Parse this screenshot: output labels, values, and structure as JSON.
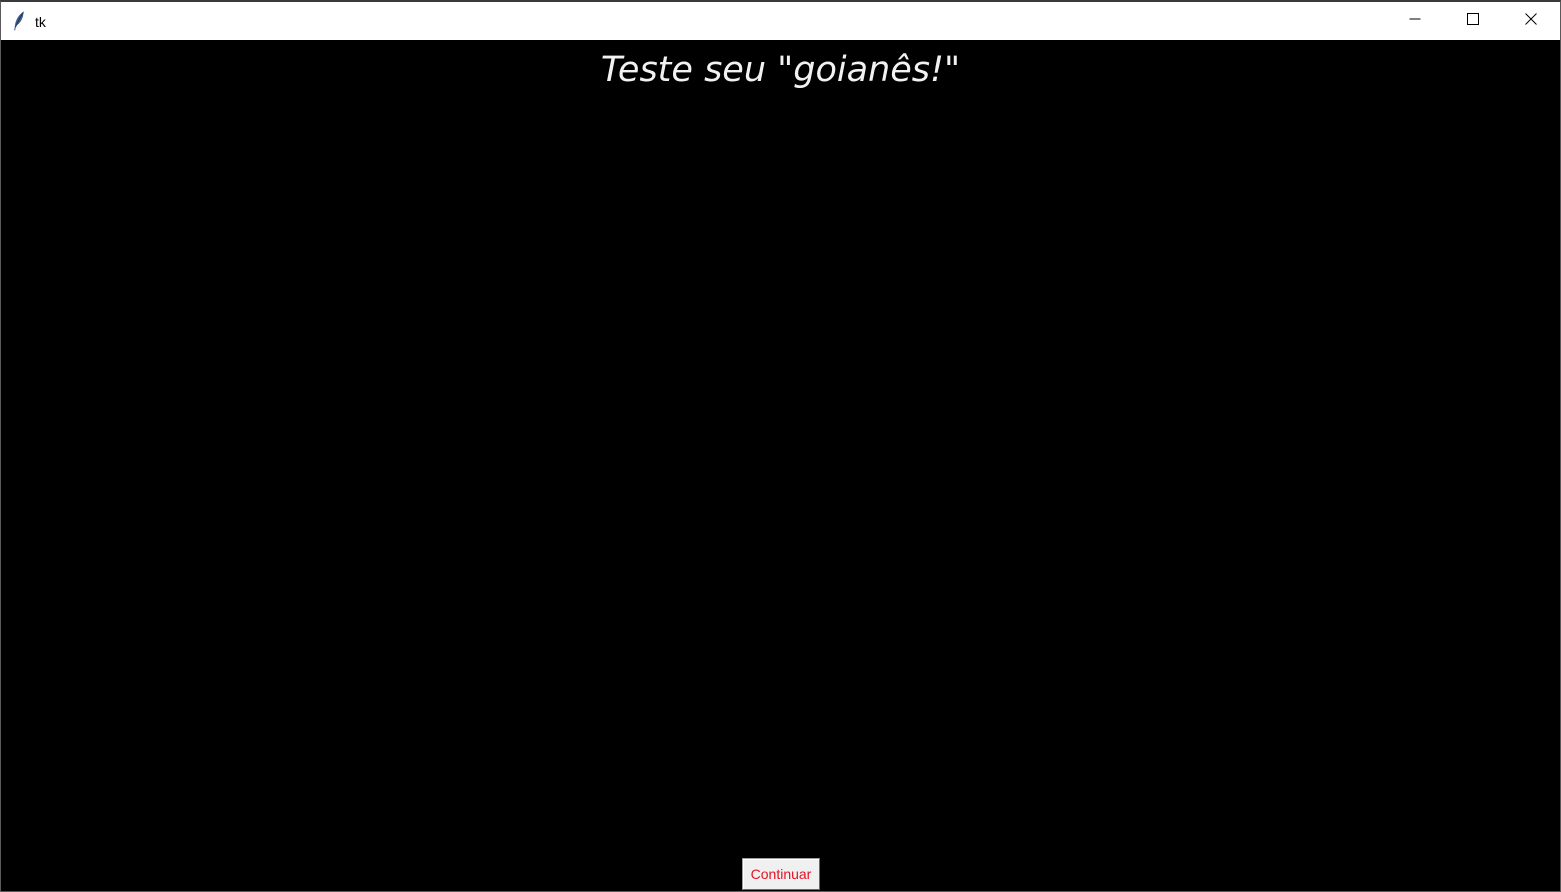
{
  "window": {
    "title": "tk",
    "icon": "tk-feather-icon",
    "controls": [
      "minimize-icon",
      "maximize-icon",
      "close-icon"
    ]
  },
  "main": {
    "heading": "Teste seu \"goianês!\"",
    "continue_label": "Continuar"
  },
  "colors": {
    "background": "#000000",
    "heading": "#f2f2f2",
    "button_text": "#e81123",
    "button_face": "#f0f0f0"
  }
}
